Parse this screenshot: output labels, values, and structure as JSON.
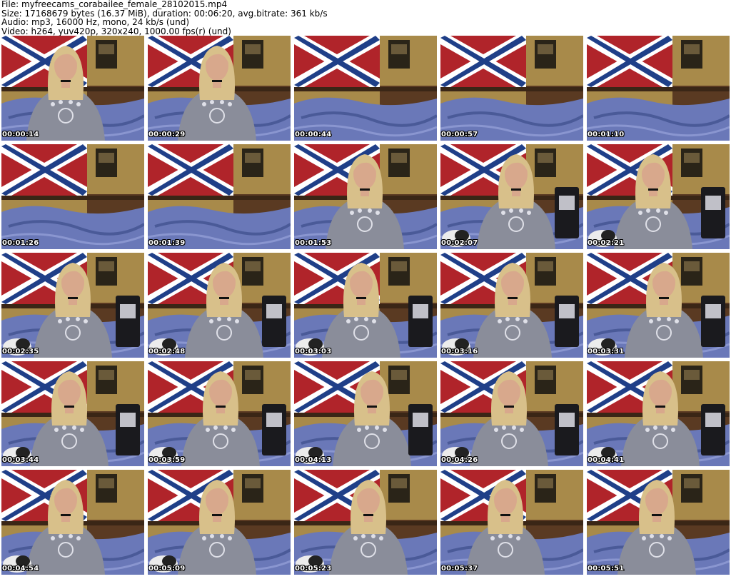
{
  "header": {
    "file": "File: myfreecams_corabailee_female_28102015.mp4",
    "size": "Size: 17168679 bytes (16.37 MiB), duration: 00:06:20, avg.bitrate: 361 kb/s",
    "audio": "Audio: mp3, 16000 Hz, mono, 24 kb/s (und)",
    "video": "Video: h264, yuv420p, 320x240, 1000.00 fps(r) (und)"
  },
  "thumbnails": [
    {
      "timestamp": "00:00:14",
      "scene": "person"
    },
    {
      "timestamp": "00:00:29",
      "scene": "person"
    },
    {
      "timestamp": "00:00:44",
      "scene": "room"
    },
    {
      "timestamp": "00:00:57",
      "scene": "room"
    },
    {
      "timestamp": "00:01:10",
      "scene": "room"
    },
    {
      "timestamp": "00:01:26",
      "scene": "room"
    },
    {
      "timestamp": "00:01:39",
      "scene": "room"
    },
    {
      "timestamp": "00:01:53",
      "scene": "person"
    },
    {
      "timestamp": "00:02:07",
      "scene": "person"
    },
    {
      "timestamp": "00:02:21",
      "scene": "person"
    },
    {
      "timestamp": "00:02:35",
      "scene": "person"
    },
    {
      "timestamp": "00:02:48",
      "scene": "person"
    },
    {
      "timestamp": "00:03:03",
      "scene": "person"
    },
    {
      "timestamp": "00:03:16",
      "scene": "person"
    },
    {
      "timestamp": "00:03:31",
      "scene": "person"
    },
    {
      "timestamp": "00:03:44",
      "scene": "person"
    },
    {
      "timestamp": "00:03:59",
      "scene": "person"
    },
    {
      "timestamp": "00:04:13",
      "scene": "person"
    },
    {
      "timestamp": "00:04:26",
      "scene": "person"
    },
    {
      "timestamp": "00:04:41",
      "scene": "person"
    },
    {
      "timestamp": "00:04:54",
      "scene": "person"
    },
    {
      "timestamp": "00:05:09",
      "scene": "person"
    },
    {
      "timestamp": "00:05:23",
      "scene": "person"
    },
    {
      "timestamp": "00:05:37",
      "scene": "person"
    },
    {
      "timestamp": "00:05:51",
      "scene": "person"
    }
  ],
  "colors": {
    "flag_red": "#b0242a",
    "flag_blue": "#1f3f88",
    "wall": "#a88a4a",
    "blanket": "#6a78b8",
    "shirt": "#8a8d9a",
    "hair": "#d8c08a",
    "skin": "#d8a88c"
  }
}
